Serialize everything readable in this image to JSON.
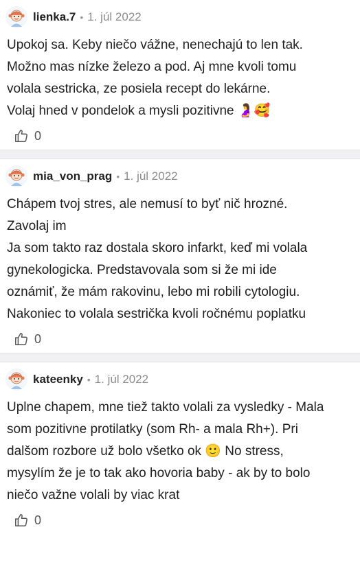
{
  "comments": [
    {
      "username": "lienka.7",
      "date": "1. júl 2022",
      "lines": [
        "Upokoj sa. Keby niečo vážne, nenechajú to len tak.",
        "Možno mas nízke železo a pod. Aj mne kvoli tomu",
        "volala sestricka, ze posiela recept do lekárne.",
        "Volaj hned v pondelok a mysli pozitivne 🤰🥰"
      ],
      "likes": "0"
    },
    {
      "username": "mia_von_prag",
      "date": "1. júl 2022",
      "lines": [
        "Chápem tvoj stres, ale nemusí to byť nič hrozné.",
        "Zavolaj im",
        "Ja som takto raz dostala skoro infarkt, keď mi volala",
        "gynekologicka. Predstavovala som si že mi ide",
        "oznámiť, že mám rakovinu, lebo mi robili cytologiu.",
        "Nakoniec to volala sestrička kvoli ročnému poplatku"
      ],
      "likes": "0"
    },
    {
      "username": "kateenky",
      "date": "1. júl 2022",
      "lines": [
        "Uplne chapem, mne tiež takto volali za vysledky - Mala",
        "som pozitivne protilatky (som Rh- a mala Rh+). Pri",
        "dalšom rozbore už bolo všetko ok 🙂 No stress,",
        "mysylím že je to tak ako hovoria baby - ak by to bolo",
        "niečo važne volali by viac krat"
      ],
      "likes": "0"
    }
  ],
  "separator_dot": "•",
  "icons": {
    "avatar": "avatar-girl-icon",
    "like": "thumbs-up-icon"
  }
}
